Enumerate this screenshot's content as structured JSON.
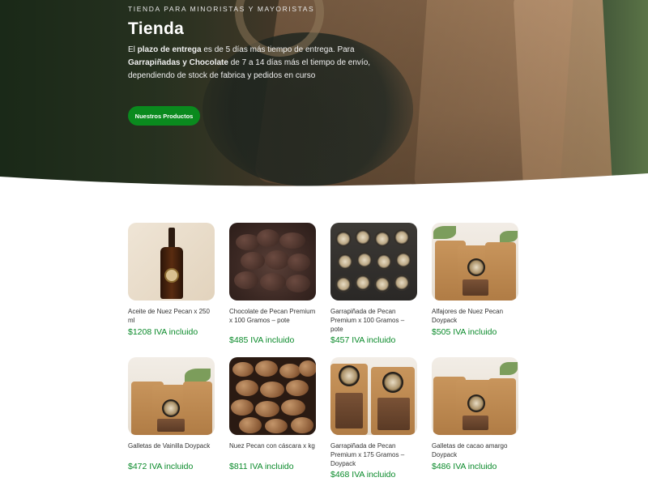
{
  "hero": {
    "kicker": "TIENDA PARA MINORISTAS Y MAYORISTAS",
    "title": "Tienda",
    "desc_pre": "El ",
    "desc_b1": "plazo de entrega",
    "desc_mid1": " es de 5 días más tiempo de entrega. Para ",
    "desc_b2": "Garrapiñadas y Chocolate",
    "desc_mid2": "  de 7 a 14 días más el tiempo de envío, dependiendo de stock de fabrica y pedidos en curso",
    "button_label": "Nuestros Productos"
  },
  "products": [
    {
      "name": "Aceite de Nuez Pecan x 250 ml",
      "price": "$1208 IVA incluido",
      "image": "oil-bottle"
    },
    {
      "name": "Chocolate de Pecan Premium x 100 Gramos – pote",
      "price": "$485 IVA incluido",
      "image": "chocolate-pecans"
    },
    {
      "name": "Garrapiñada de Pecan Premium x 100 Gramos – pote",
      "price": "$457 IVA incluido",
      "image": "jars"
    },
    {
      "name": "Alfajores de Nuez Pecan Doypack",
      "price": "$505 IVA incluido",
      "image": "doypack-bags"
    },
    {
      "name": "Galletas de Vainilla Doypack",
      "price": "$472 IVA incluido",
      "image": "doypack-bags"
    },
    {
      "name": "Nuez Pecan con cáscara x kg",
      "price": "$811 IVA incluido",
      "image": "pecans-in-shell"
    },
    {
      "name": "Garrapiñada de Pecan Premium x 175 Gramos – Doypack",
      "price": "$468 IVA incluido",
      "image": "doypack-bags"
    },
    {
      "name": "Galletas de cacao amargo Doypack",
      "price": "$486 IVA incluido",
      "image": "doypack-bags"
    }
  ],
  "colors": {
    "accent": "#0a8a1e",
    "price": "#0a8a2a"
  }
}
